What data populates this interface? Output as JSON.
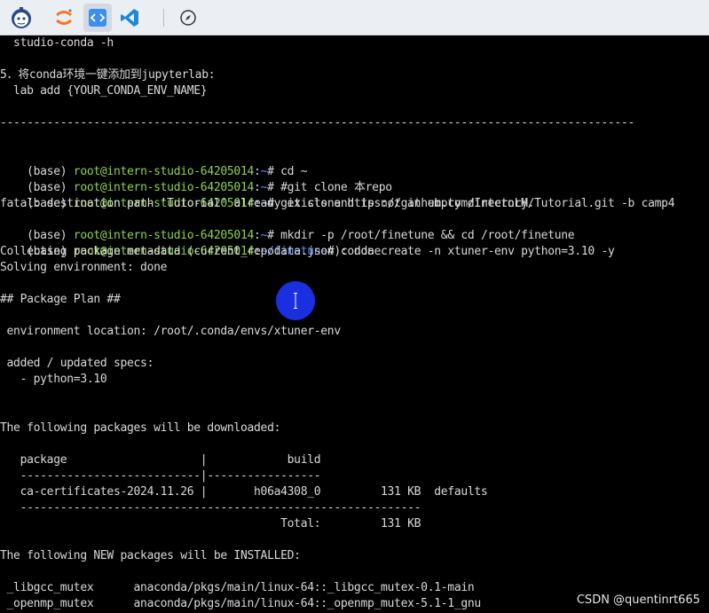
{
  "toolbar": {
    "icons": [
      "mascot-logo-icon",
      "jupyter-icon",
      "code-icon",
      "vscode-icon",
      "compass-icon"
    ],
    "active": "code-icon"
  },
  "colors": {
    "prompt_user": "#8fd14f",
    "prompt_path": "#5c8cff",
    "text": "#d9d9d9",
    "background": "#000000",
    "cursor": "#1a2fe0"
  },
  "terminal": {
    "lines": [
      "  studio-conda -h",
      "",
      "5．将conda环境一键添加到jupyterlab:",
      "  lab add {YOUR_CONDA_ENV_NAME}",
      "",
      "-----------------------------------------------------------------------------------------------",
      "",
      "",
      "",
      "",
      "",
      "",
      "Collecting package metadata (current_repodata.json): done",
      "Solving environment: done",
      "",
      "## Package Plan ##",
      "",
      " environment location: /root/.conda/envs/xtuner-env",
      "",
      " added / updated specs:",
      "   - python=3.10",
      "",
      "",
      "The following packages will be downloaded:",
      "",
      "   package                    |            build",
      "   ---------------------------|-----------------",
      "   ca-certificates-2024.11.26 |       h06a4308_0         131 KB  defaults",
      "   ------------------------------------------------------------",
      "                                          Total:         131 KB",
      "",
      "The following NEW packages will be INSTALLED:",
      "",
      " _libgcc_mutex      anaconda/pkgs/main/linux-64::_libgcc_mutex-0.1-main",
      " _openmp_mutex      anaconda/pkgs/main/linux-64::_openmp_mutex-5.1-1_gnu"
    ],
    "prompts": [
      {
        "env": "(base) ",
        "user": "root@intern-studio-64205014",
        "sep": ":",
        "path": "~",
        "cmd": "# cd ~"
      },
      {
        "env": "(base) ",
        "user": "root@intern-studio-64205014",
        "sep": ":",
        "path": "~",
        "cmd": "# #git clone 本repo"
      },
      {
        "env": "(base) ",
        "user": "root@intern-studio-64205014",
        "sep": ":",
        "path": "~",
        "cmd": "# git clone https://github.com/InternLM/Tutorial.git -b camp4"
      },
      {
        "text": "fatal: destination path 'Tutorial' already exists and is not an empty directory."
      },
      {
        "env": "(base) ",
        "user": "root@intern-studio-64205014",
        "sep": ":",
        "path": "~",
        "cmd": "# mkdir -p /root/finetune && cd /root/finetune"
      },
      {
        "env": "(base) ",
        "user": "root@intern-studio-64205014",
        "sep": ":",
        "path": "~/finetune",
        "cmd": "# conda create -n xtuner-env python=3.10 -y"
      }
    ]
  },
  "watermark": "CSDN @quentinrt665"
}
